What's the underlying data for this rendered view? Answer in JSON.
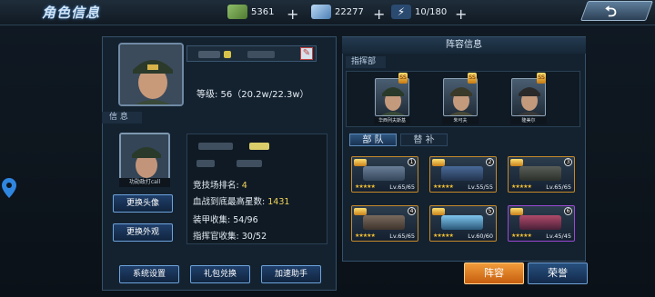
{
  "header": {
    "title": "角色信息",
    "resources": [
      {
        "icon": "cash-stack-icon",
        "value": "5361"
      },
      {
        "icon": "diamond-icon",
        "value": "22277"
      },
      {
        "icon": "energy-bolt-icon",
        "value": "10/180"
      }
    ]
  },
  "profile": {
    "level_text": "等级: 56（20.2w/22.3w）",
    "info_tab": "信 息",
    "avatar_name": "功勋政打call",
    "change_avatar": "更换头像",
    "change_look": "更换外观",
    "stats": [
      {
        "label": "竞技场排名:",
        "value": "4"
      },
      {
        "label": "血战到底最高星数:",
        "value": "1431"
      },
      {
        "label": "装甲收集:",
        "value": "54/96"
      },
      {
        "label": "指挥官收集:",
        "value": "30/52"
      }
    ]
  },
  "bottom_buttons": [
    "系统设置",
    "礼包兑换",
    "加速助手"
  ],
  "lineup": {
    "title": "阵容信息",
    "commander_tab": "指挥部",
    "commanders": [
      {
        "name": "华西列夫斯基",
        "rank": "SS"
      },
      {
        "name": "朱可夫",
        "rank": "SS"
      },
      {
        "name": "隆美尔",
        "rank": "SS"
      }
    ],
    "tabs": [
      "部 队",
      "替 补"
    ],
    "tanks": [
      {
        "num": "1",
        "level": "Lv.65/65",
        "stars": "★★★★★"
      },
      {
        "num": "2",
        "level": "Lv.55/55",
        "stars": "★★★★★"
      },
      {
        "num": "3",
        "level": "Lv.65/65",
        "stars": "★★★★★"
      },
      {
        "num": "4",
        "level": "Lv.65/65",
        "stars": "★★★★★"
      },
      {
        "num": "5",
        "level": "Lv.60/60",
        "stars": "★★★★★"
      },
      {
        "num": "6",
        "level": "Lv.45/45",
        "stars": "★★★★★"
      }
    ]
  },
  "actions": {
    "lineup": "阵容",
    "honor": "荣誉"
  },
  "colors": {
    "accent_orange": "#e8872a",
    "stat_yellow": "#f2d45b",
    "panel_border": "#35506a"
  }
}
